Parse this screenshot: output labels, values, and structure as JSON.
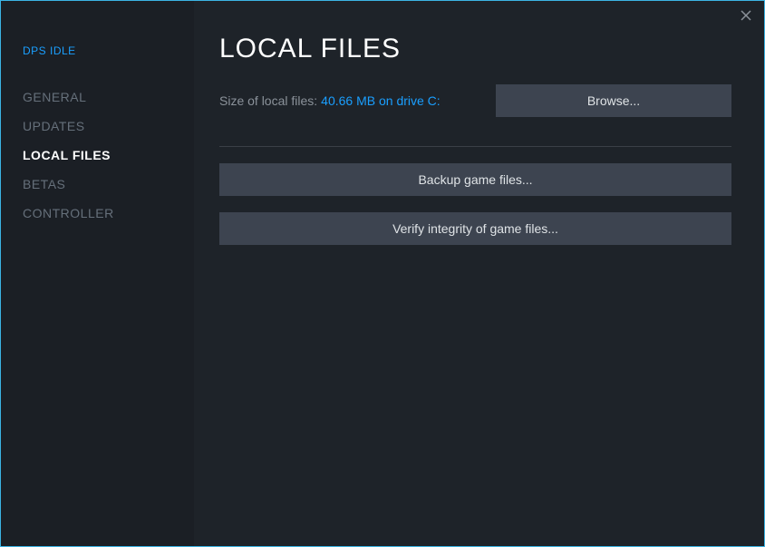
{
  "game_title": "DPS IDLE",
  "sidebar": {
    "items": [
      {
        "label": "GENERAL",
        "active": false
      },
      {
        "label": "UPDATES",
        "active": false
      },
      {
        "label": "LOCAL FILES",
        "active": true
      },
      {
        "label": "BETAS",
        "active": false
      },
      {
        "label": "CONTROLLER",
        "active": false
      }
    ]
  },
  "content": {
    "title": "LOCAL FILES",
    "size_label": "Size of local files:",
    "size_value": "40.66 MB on drive C:",
    "browse_label": "Browse...",
    "backup_label": "Backup game files...",
    "verify_label": "Verify integrity of game files..."
  }
}
